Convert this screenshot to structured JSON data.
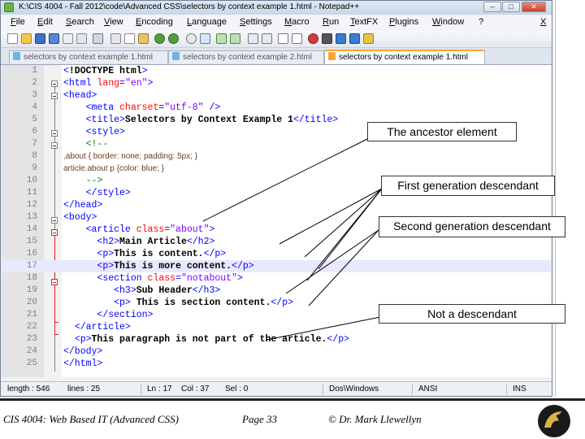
{
  "window": {
    "title": "K:\\CIS 4004 - Fall 2012\\code\\Advanced CSS\\selectors by context example 1.html - Notepad++",
    "controls": {
      "minimize": "–",
      "maximize": "□",
      "close": "✕"
    }
  },
  "menu": [
    "File",
    "Edit",
    "Search",
    "View",
    "Encoding",
    "Language",
    "Settings",
    "Macro",
    "Run",
    "TextFX",
    "Plugins",
    "Window",
    "?"
  ],
  "menu_close": "X",
  "tabs": [
    {
      "label": "selectors by context example 1.html",
      "active": false
    },
    {
      "label": "selectors by context example 2.html",
      "active": false
    },
    {
      "label": "selectors by context example 1.html",
      "active": true
    }
  ],
  "code": {
    "highlighted_line": 17,
    "lines": [
      {
        "n": "1",
        "segs": [
          [
            "tag",
            "<"
          ],
          [
            "dt",
            "!DOCTYPE html"
          ],
          [
            "tag",
            ">"
          ]
        ]
      },
      {
        "n": "2",
        "segs": [
          [
            "tag",
            "<html "
          ],
          [
            "attr",
            "lang"
          ],
          [
            "tag",
            "="
          ],
          [
            "val",
            "\"en\""
          ],
          [
            "tag",
            ">"
          ]
        ]
      },
      {
        "n": "3",
        "segs": [
          [
            "tag",
            "<head>"
          ]
        ]
      },
      {
        "n": "4",
        "segs": [
          [
            "txt",
            "    "
          ],
          [
            "tag",
            "<meta "
          ],
          [
            "attr",
            "charset"
          ],
          [
            "tag",
            "="
          ],
          [
            "val",
            "\"utf-8\""
          ],
          [
            "tag",
            " />"
          ]
        ]
      },
      {
        "n": "5",
        "segs": [
          [
            "txt",
            "    "
          ],
          [
            "tag",
            "<title>"
          ],
          [
            "txt",
            "Selectors by Context Example 1"
          ],
          [
            "tag",
            "</title>"
          ]
        ]
      },
      {
        "n": "6",
        "segs": [
          [
            "txt",
            "    "
          ],
          [
            "tag",
            "<style>"
          ]
        ]
      },
      {
        "n": "7",
        "segs": [
          [
            "txt",
            "    "
          ],
          [
            "cm",
            "<!--"
          ]
        ]
      },
      {
        "n": "8",
        "css": true,
        "segs": [
          [
            "css",
            ".about { border: none; padding: 5px; }"
          ]
        ]
      },
      {
        "n": "9",
        "css": true,
        "segs": [
          [
            "css",
            "article.about p {color: blue; }"
          ]
        ]
      },
      {
        "n": "10",
        "segs": [
          [
            "txt",
            "    "
          ],
          [
            "cm",
            "-->"
          ]
        ]
      },
      {
        "n": "11",
        "segs": [
          [
            "txt",
            "    "
          ],
          [
            "tag",
            "</style>"
          ]
        ]
      },
      {
        "n": "12",
        "segs": [
          [
            "tag",
            "</head>"
          ]
        ]
      },
      {
        "n": "13",
        "segs": [
          [
            "tag",
            "<body>"
          ]
        ]
      },
      {
        "n": "14",
        "segs": [
          [
            "txt",
            "    "
          ],
          [
            "tag",
            "<article "
          ],
          [
            "attr",
            "class"
          ],
          [
            "tag",
            "="
          ],
          [
            "val",
            "\"about\""
          ],
          [
            "tag",
            ">"
          ]
        ]
      },
      {
        "n": "15",
        "segs": [
          [
            "txt",
            "      "
          ],
          [
            "tag",
            "<h2>"
          ],
          [
            "txt",
            "Main Article"
          ],
          [
            "tag",
            "</h2>"
          ]
        ]
      },
      {
        "n": "16",
        "segs": [
          [
            "txt",
            "      "
          ],
          [
            "tag",
            "<p>"
          ],
          [
            "txt",
            "This is content."
          ],
          [
            "tag",
            "</p>"
          ]
        ]
      },
      {
        "n": "17",
        "segs": [
          [
            "txt",
            "      "
          ],
          [
            "tag",
            "<p>"
          ],
          [
            "txt",
            "This is more content."
          ],
          [
            "tag",
            "</p>"
          ]
        ]
      },
      {
        "n": "18",
        "segs": [
          [
            "txt",
            "      "
          ],
          [
            "tag",
            "<section "
          ],
          [
            "attr",
            "class"
          ],
          [
            "tag",
            "="
          ],
          [
            "val",
            "\"notabout\""
          ],
          [
            "tag",
            ">"
          ]
        ]
      },
      {
        "n": "19",
        "segs": [
          [
            "txt",
            "         "
          ],
          [
            "tag",
            "<h3>"
          ],
          [
            "txt",
            "Sub Header"
          ],
          [
            "tag",
            "</h3>"
          ]
        ]
      },
      {
        "n": "20",
        "segs": [
          [
            "txt",
            "         "
          ],
          [
            "tag",
            "<p>"
          ],
          [
            "txt",
            " This is section content."
          ],
          [
            "tag",
            "</p>"
          ]
        ]
      },
      {
        "n": "21",
        "segs": [
          [
            "txt",
            "      "
          ],
          [
            "tag",
            "</section>"
          ]
        ]
      },
      {
        "n": "22",
        "segs": [
          [
            "txt",
            "  "
          ],
          [
            "tag",
            "</article>"
          ]
        ]
      },
      {
        "n": "23",
        "segs": [
          [
            "txt",
            "  "
          ],
          [
            "tag",
            "<p>"
          ],
          [
            "txt",
            "This paragraph is not part of the article."
          ],
          [
            "tag",
            "</p>"
          ]
        ]
      },
      {
        "n": "24",
        "segs": [
          [
            "tag",
            "</body>"
          ]
        ]
      },
      {
        "n": "25",
        "segs": [
          [
            "tag",
            "</html>"
          ]
        ]
      }
    ]
  },
  "status": {
    "length": "length : 546",
    "lines": "lines : 25",
    "ln": "Ln : 17",
    "col": "Col : 37",
    "sel": "Sel : 0",
    "eol": "Dos\\Windows",
    "encoding": "ANSI",
    "mode": "INS"
  },
  "callouts": {
    "ancestor": "The ancestor element",
    "first_gen": "First generation descendant",
    "second_gen": "Second generation descendant",
    "not_desc": "Not a descendant"
  },
  "footer": {
    "course": "CIS 4004: Web Based IT (Advanced CSS)",
    "page": "Page 33",
    "author": "© Dr. Mark Llewellyn"
  },
  "colors": {
    "tag": "#0000ff",
    "attr": "#ff0000",
    "value": "#8000ff",
    "comment": "#008000",
    "tab_accent": "#f7a53a",
    "highlight_line": "#e8e8ff"
  },
  "icons": [
    "app-notepadpp-icon",
    "new-file-icon",
    "open-icon",
    "save-icon",
    "save-all-icon",
    "close-icon",
    "close-all-icon",
    "print-icon",
    "cut-icon",
    "copy-icon",
    "paste-icon",
    "undo-icon",
    "redo-icon",
    "find-icon",
    "replace-icon",
    "zoom-in-icon",
    "zoom-out-icon",
    "sync-scroll-icon",
    "word-wrap-icon",
    "show-all-icon",
    "indent-guide-icon",
    "macro-record-icon",
    "macro-stop-icon",
    "macro-play-icon",
    "macro-repeat-icon",
    "macro-save-icon",
    "ucf-logo"
  ]
}
